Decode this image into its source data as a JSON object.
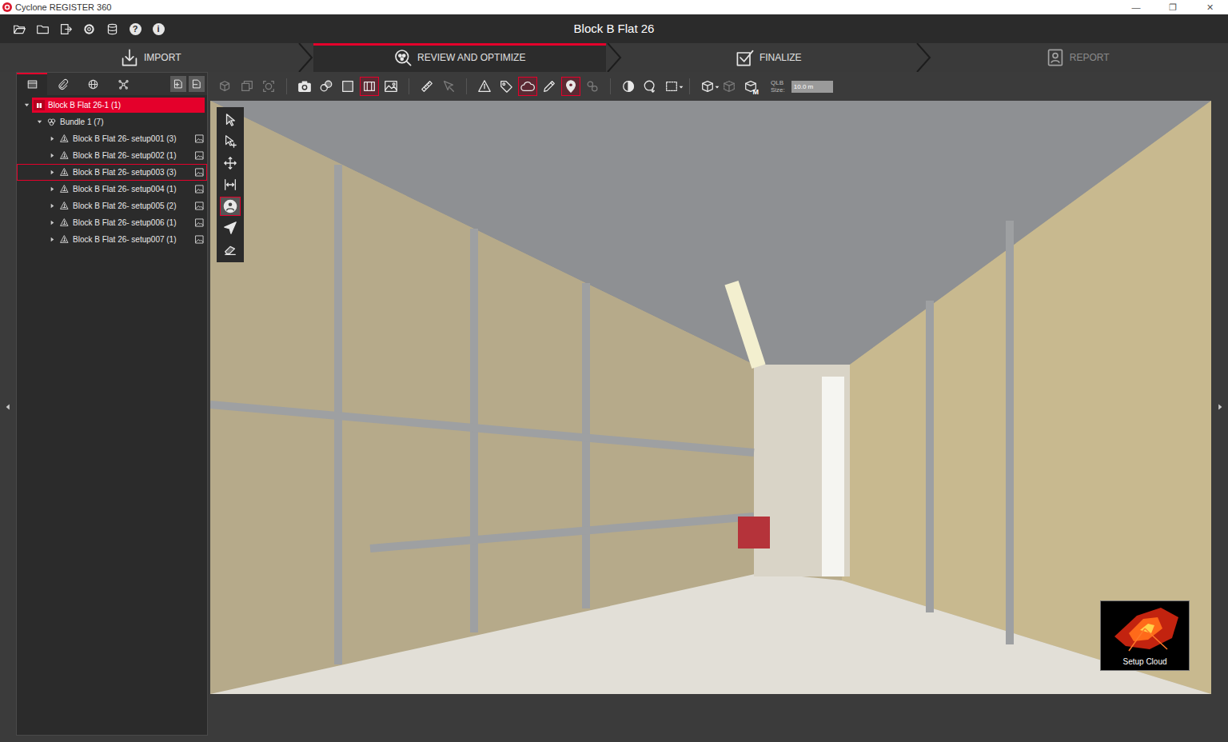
{
  "window": {
    "title": "Cyclone REGISTER 360",
    "controls": [
      "—",
      "❐",
      "✕"
    ]
  },
  "menu": {
    "icons": [
      {
        "kind": "folder-open"
      },
      {
        "kind": "folder"
      },
      {
        "kind": "export"
      },
      {
        "kind": "gear"
      },
      {
        "kind": "database"
      },
      {
        "kind": "help",
        "glyph": "?"
      },
      {
        "kind": "info",
        "glyph": "i"
      }
    ],
    "title": "Block B Flat 26"
  },
  "workflow_tabs": [
    {
      "label": "IMPORT",
      "kind": "import",
      "selected": false,
      "disabled": false
    },
    {
      "label": "REVIEW AND OPTIMIZE",
      "kind": "review",
      "selected": true,
      "disabled": false
    },
    {
      "label": "FINALIZE",
      "kind": "finalize",
      "selected": false,
      "disabled": false
    },
    {
      "label": "REPORT",
      "kind": "report",
      "selected": false,
      "disabled": true
    }
  ],
  "panel_tabs": [
    {
      "kind": "project",
      "selected": true
    },
    {
      "kind": "clip",
      "selected": false
    },
    {
      "kind": "globe",
      "selected": false
    },
    {
      "kind": "network",
      "selected": false
    }
  ],
  "panel_buttons": [
    {
      "kind": "bundle-add"
    },
    {
      "kind": "bundle-remove"
    }
  ],
  "tree": {
    "root": {
      "label": "Block B Flat 26-1 (1)",
      "expanded": true,
      "selected": true
    },
    "bundle": {
      "label": "Bundle 1 (7)",
      "expanded": true
    },
    "setups": [
      {
        "label": "Block B Flat 26- setup001 (3)",
        "expanded": false,
        "selected": false
      },
      {
        "label": "Block B Flat 26- setup002 (1)",
        "expanded": false,
        "selected": false
      },
      {
        "label": "Block B Flat 26- setup003 (3)",
        "expanded": false,
        "selected": true
      },
      {
        "label": "Block B Flat 26- setup004 (1)",
        "expanded": false,
        "selected": false
      },
      {
        "label": "Block B Flat 26- setup005 (2)",
        "expanded": false,
        "selected": false
      },
      {
        "label": "Block B Flat 26- setup006 (1)",
        "expanded": false,
        "selected": false
      },
      {
        "label": "Block B Flat 26- setup007 (1)",
        "expanded": false,
        "selected": false
      }
    ]
  },
  "toolbar": [
    [
      {
        "kind": "cube-link",
        "active": false,
        "disabled": true
      },
      {
        "kind": "layers",
        "active": false,
        "disabled": true
      },
      {
        "kind": "zoom-fit",
        "active": false,
        "disabled": true
      }
    ],
    [
      {
        "kind": "camera",
        "active": false,
        "disabled": false
      },
      {
        "kind": "spheres",
        "active": false,
        "disabled": false
      },
      {
        "kind": "square",
        "active": false,
        "disabled": false
      },
      {
        "kind": "limit-box",
        "active": true,
        "disabled": false
      },
      {
        "kind": "image",
        "active": false,
        "disabled": false
      }
    ],
    [
      {
        "kind": "ruler",
        "active": false,
        "disabled": false
      },
      {
        "kind": "measure-pointer",
        "active": false,
        "disabled": true
      }
    ],
    [
      {
        "kind": "triangle",
        "active": false,
        "disabled": false
      },
      {
        "kind": "tag",
        "active": false,
        "disabled": false
      },
      {
        "kind": "cloud",
        "active": true,
        "disabled": false
      },
      {
        "kind": "pencil",
        "active": false,
        "disabled": false
      },
      {
        "kind": "pin",
        "active": true,
        "disabled": false
      },
      {
        "kind": "link",
        "active": false,
        "disabled": true
      }
    ],
    [
      {
        "kind": "sphere-color",
        "active": false,
        "disabled": false
      },
      {
        "kind": "sphere-pin",
        "active": false,
        "disabled": false
      },
      {
        "kind": "select-box-menu",
        "active": false,
        "disabled": false
      }
    ],
    [
      {
        "kind": "cube-menu",
        "active": false,
        "disabled": false
      },
      {
        "kind": "cube-dim",
        "active": false,
        "disabled": true
      },
      {
        "kind": "cube-m",
        "active": false,
        "disabled": false,
        "glyph": "M"
      }
    ]
  ],
  "qlb": {
    "label_top": "QLB",
    "label_bottom": "Size:",
    "value": "10.0 m"
  },
  "side_tools": [
    {
      "kind": "arrow",
      "active": false
    },
    {
      "kind": "arrow-plus",
      "active": false
    },
    {
      "kind": "pan",
      "active": false
    },
    {
      "kind": "fit",
      "active": false
    },
    {
      "kind": "person",
      "active": true
    },
    {
      "kind": "plane",
      "active": false
    },
    {
      "kind": "eraser",
      "active": false
    }
  ],
  "viewport": {
    "thumbnail": {
      "label": "Setup Cloud"
    }
  }
}
